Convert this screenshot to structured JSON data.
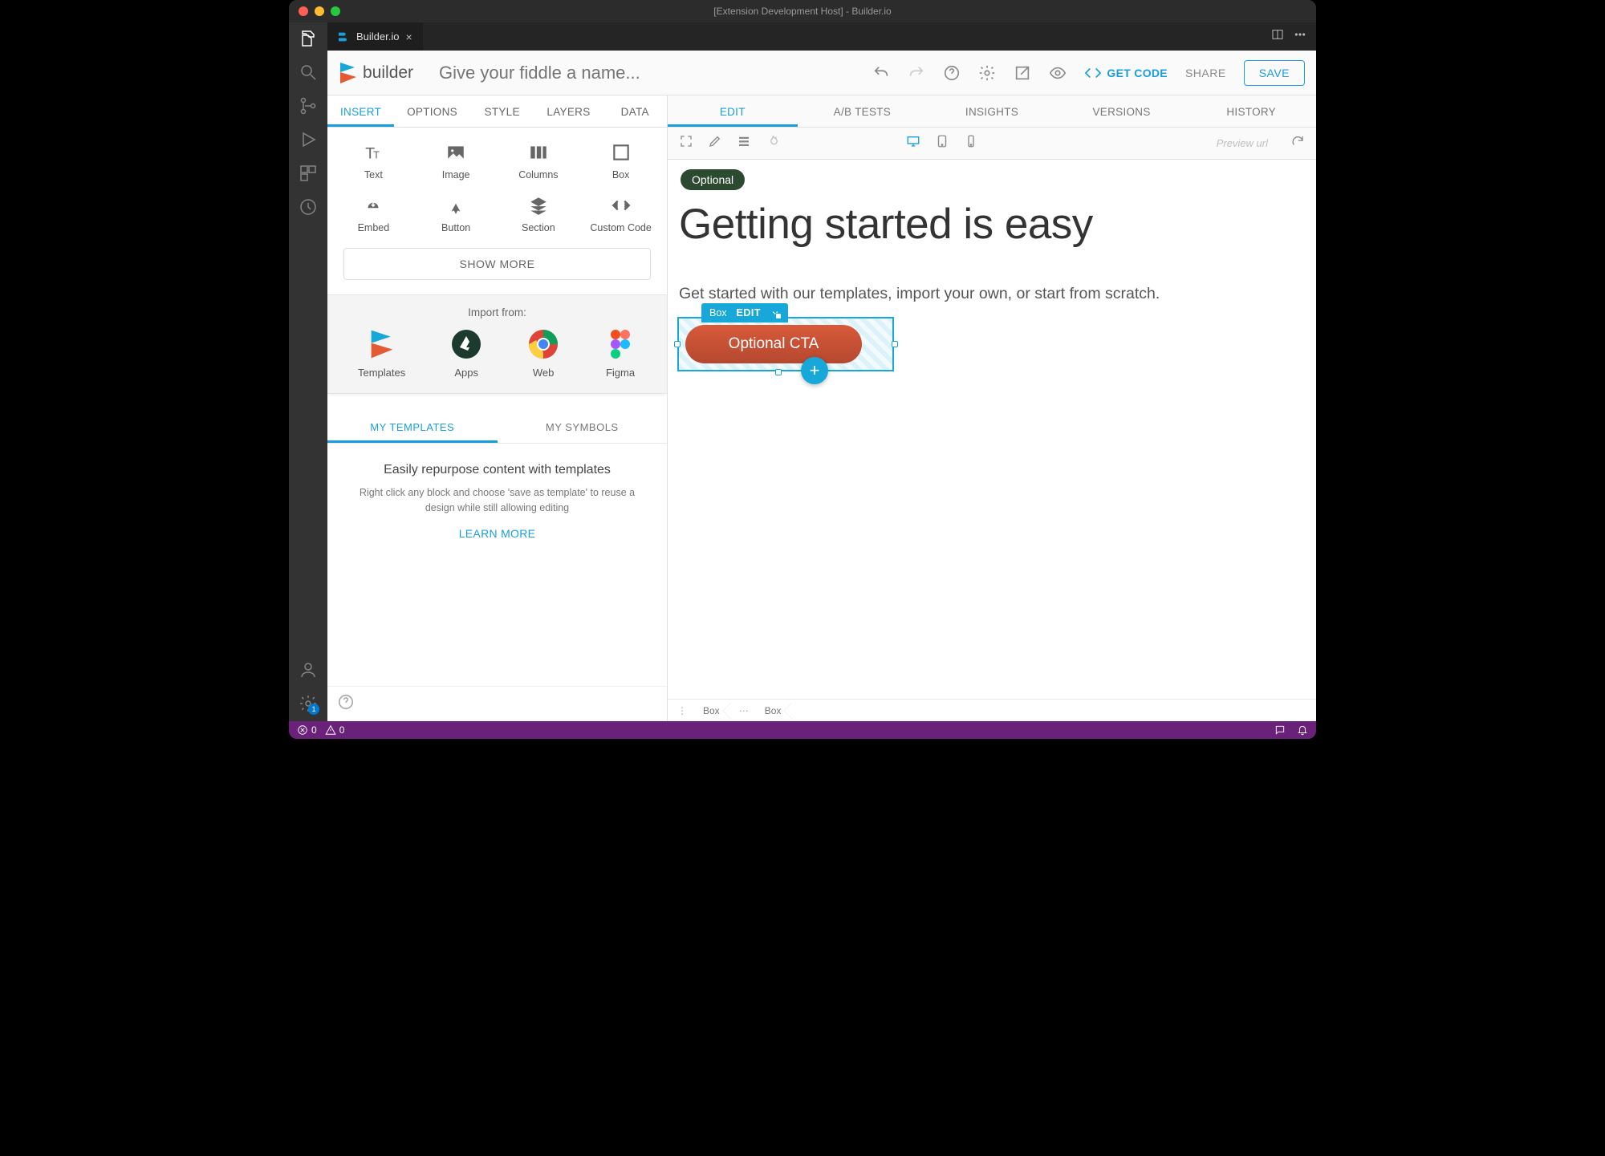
{
  "window": {
    "title": "[Extension Development Host] - Builder.io"
  },
  "activitybar": {
    "settings_badge": "1"
  },
  "tab": {
    "title": "Builder.io"
  },
  "builder": {
    "brand": "builder",
    "name_placeholder": "Give your fiddle a name...",
    "getcode": "GET CODE",
    "share": "SHARE",
    "save": "SAVE"
  },
  "left_tabs": [
    "INSERT",
    "OPTIONS",
    "STYLE",
    "LAYERS",
    "DATA"
  ],
  "left_tabs_active": 0,
  "blocks": [
    {
      "label": "Text",
      "icon": "text"
    },
    {
      "label": "Image",
      "icon": "image"
    },
    {
      "label": "Columns",
      "icon": "columns"
    },
    {
      "label": "Box",
      "icon": "box"
    },
    {
      "label": "Embed",
      "icon": "embed"
    },
    {
      "label": "Button",
      "icon": "button"
    },
    {
      "label": "Section",
      "icon": "section"
    },
    {
      "label": "Custom Code",
      "icon": "code"
    }
  ],
  "showmore": "SHOW MORE",
  "import": {
    "title": "Import from:",
    "items": [
      "Templates",
      "Apps",
      "Web",
      "Figma"
    ]
  },
  "sub_tabs": [
    "MY TEMPLATES",
    "MY SYMBOLS"
  ],
  "sub_tabs_active": 0,
  "templates": {
    "heading": "Easily repurpose content with templates",
    "sub": "Right click any block and choose 'save as template' to reuse a design while still allowing editing",
    "cta": "LEARN MORE"
  },
  "right_tabs": [
    "EDIT",
    "A/B TESTS",
    "INSIGHTS",
    "VERSIONS",
    "HISTORY"
  ],
  "right_tabs_active": 0,
  "toolbar": {
    "preview_placeholder": "Preview url"
  },
  "canvas": {
    "badge": "Optional",
    "heading": "Getting started is easy",
    "sub": "Get started with our templates, import your own, or start from scratch.",
    "selection": {
      "type": "Box",
      "action": "EDIT"
    },
    "cta_text": "Optional CTA"
  },
  "breadcrumb": [
    "Box",
    "Box"
  ],
  "status": {
    "errors": "0",
    "warnings": "0"
  }
}
